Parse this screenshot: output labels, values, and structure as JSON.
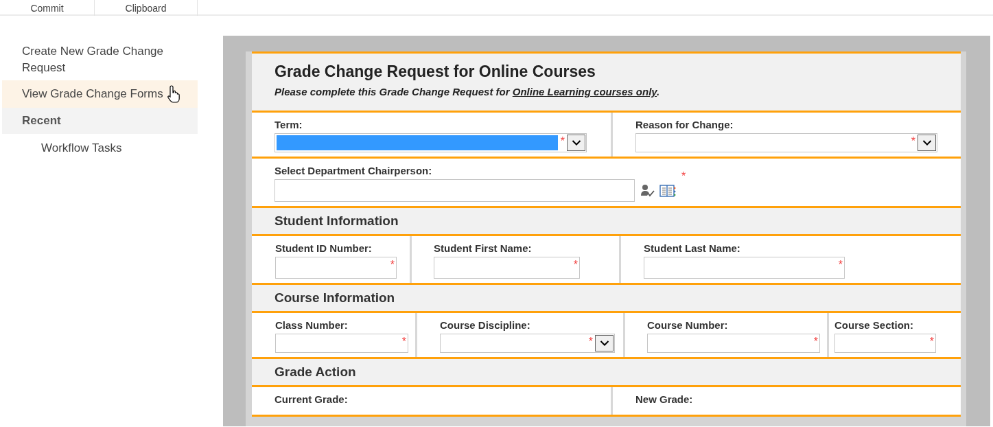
{
  "ribbon": {
    "groups": [
      "Commit",
      "Clipboard"
    ]
  },
  "nav": {
    "items": [
      {
        "label": "Create New Grade Change Request",
        "kind": "link",
        "selected": false
      },
      {
        "label": "View Grade Change Forms",
        "kind": "link",
        "selected": true
      },
      {
        "label": "Recent",
        "kind": "header",
        "selected": false
      },
      {
        "label": "Workflow Tasks",
        "kind": "sublink",
        "selected": false
      }
    ]
  },
  "form": {
    "title": "Grade Change Request for Online Courses",
    "subtitle": {
      "text": "Please complete this Grade Change Request for ",
      "link": "Online Learning courses only",
      "end": "."
    },
    "sections": [
      {
        "rows": [
          {
            "cells": [
              {
                "label": "Term:",
                "field": {
                  "kind": "select",
                  "focused": true,
                  "mark": "*"
                }
              },
              {
                "label": "Reason for Change:",
                "field": {
                  "kind": "select",
                  "focused": false,
                  "mark": "*"
                }
              }
            ]
          },
          {
            "cells": [
              {
                "label": "Select Department Chairperson:",
                "field": {
                  "kind": "people",
                  "focused": false,
                  "mark": "*"
                }
              }
            ]
          }
        ]
      },
      {
        "heading": "Student Information",
        "rows": [
          {
            "cells": [
              {
                "label": "Student ID Number:",
                "field": {
                  "kind": "text",
                  "focused": false,
                  "mark": "*"
                }
              },
              {
                "label": "Student First Name:",
                "field": {
                  "kind": "text",
                  "focused": false,
                  "mark": "*"
                }
              },
              {
                "label": "Student Last Name:",
                "field": {
                  "kind": "text",
                  "focused": false,
                  "mark": "*"
                }
              }
            ]
          }
        ]
      },
      {
        "heading": "Course Information",
        "rows": [
          {
            "cells": [
              {
                "label": "Class Number:",
                "field": {
                  "kind": "text",
                  "focused": false,
                  "mark": "*"
                }
              },
              {
                "label": "Course Discipline:",
                "field": {
                  "kind": "select",
                  "focused": false,
                  "mark": "*"
                }
              },
              {
                "label": "Course Number:",
                "field": {
                  "kind": "text",
                  "focused": false,
                  "mark": "*"
                }
              },
              {
                "label": "Course Section:",
                "field": {
                  "kind": "text",
                  "focused": false,
                  "mark": "*"
                }
              }
            ]
          }
        ]
      },
      {
        "heading": "Grade Action",
        "rows": [
          {
            "cells": [
              {
                "label": "Current Grade:"
              },
              {
                "label": "New Grade:"
              }
            ]
          }
        ]
      }
    ]
  }
}
